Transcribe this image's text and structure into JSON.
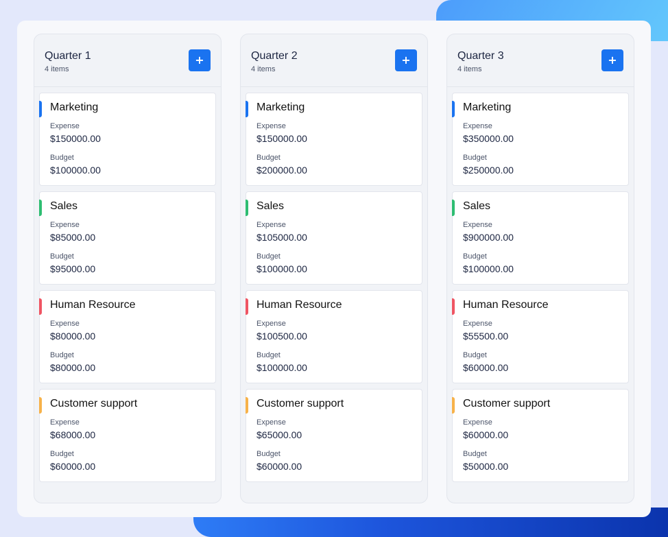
{
  "colors": {
    "marketing": "#1a73f0",
    "sales": "#2ebd72",
    "human_resource": "#ef5563",
    "customer_support": "#f7b24a",
    "button": "#1a73f0"
  },
  "add_icon": "plus-icon",
  "columns": [
    {
      "title": "Quarter 1",
      "count": "4 items",
      "add_label": "+",
      "cards": [
        {
          "title": "Marketing",
          "expense_label": "Expense",
          "expense": "$150000.00",
          "budget_label": "Budget",
          "budget": "$100000.00"
        },
        {
          "title": "Sales",
          "expense_label": "Expense",
          "expense": "$85000.00",
          "budget_label": "Budget",
          "budget": "$95000.00"
        },
        {
          "title": "Human Resource",
          "expense_label": "Expense",
          "expense": "$80000.00",
          "budget_label": "Budget",
          "budget": "$80000.00"
        },
        {
          "title": "Customer support",
          "expense_label": "Expense",
          "expense": "$68000.00",
          "budget_label": "Budget",
          "budget": "$60000.00"
        }
      ]
    },
    {
      "title": "Quarter 2",
      "count": "4 items",
      "add_label": "+",
      "cards": [
        {
          "title": "Marketing",
          "expense_label": "Expense",
          "expense": "$150000.00",
          "budget_label": "Budget",
          "budget": "$200000.00"
        },
        {
          "title": "Sales",
          "expense_label": "Expense",
          "expense": "$105000.00",
          "budget_label": "Budget",
          "budget": "$100000.00"
        },
        {
          "title": "Human Resource",
          "expense_label": "Expense",
          "expense": "$100500.00",
          "budget_label": "Budget",
          "budget": "$100000.00"
        },
        {
          "title": "Customer support",
          "expense_label": "Expense",
          "expense": "$65000.00",
          "budget_label": "Budget",
          "budget": "$60000.00"
        }
      ]
    },
    {
      "title": "Quarter 3",
      "count": "4 items",
      "add_label": "+",
      "cards": [
        {
          "title": "Marketing",
          "expense_label": "Expense",
          "expense": "$350000.00",
          "budget_label": "Budget",
          "budget": "$250000.00"
        },
        {
          "title": "Sales",
          "expense_label": "Expense",
          "expense": "$900000.00",
          "budget_label": "Budget",
          "budget": "$100000.00"
        },
        {
          "title": "Human Resource",
          "expense_label": "Expense",
          "expense": "$55500.00",
          "budget_label": "Budget",
          "budget": "$60000.00"
        },
        {
          "title": "Customer support",
          "expense_label": "Expense",
          "expense": "$60000.00",
          "budget_label": "Budget",
          "budget": "$50000.00"
        }
      ]
    }
  ]
}
